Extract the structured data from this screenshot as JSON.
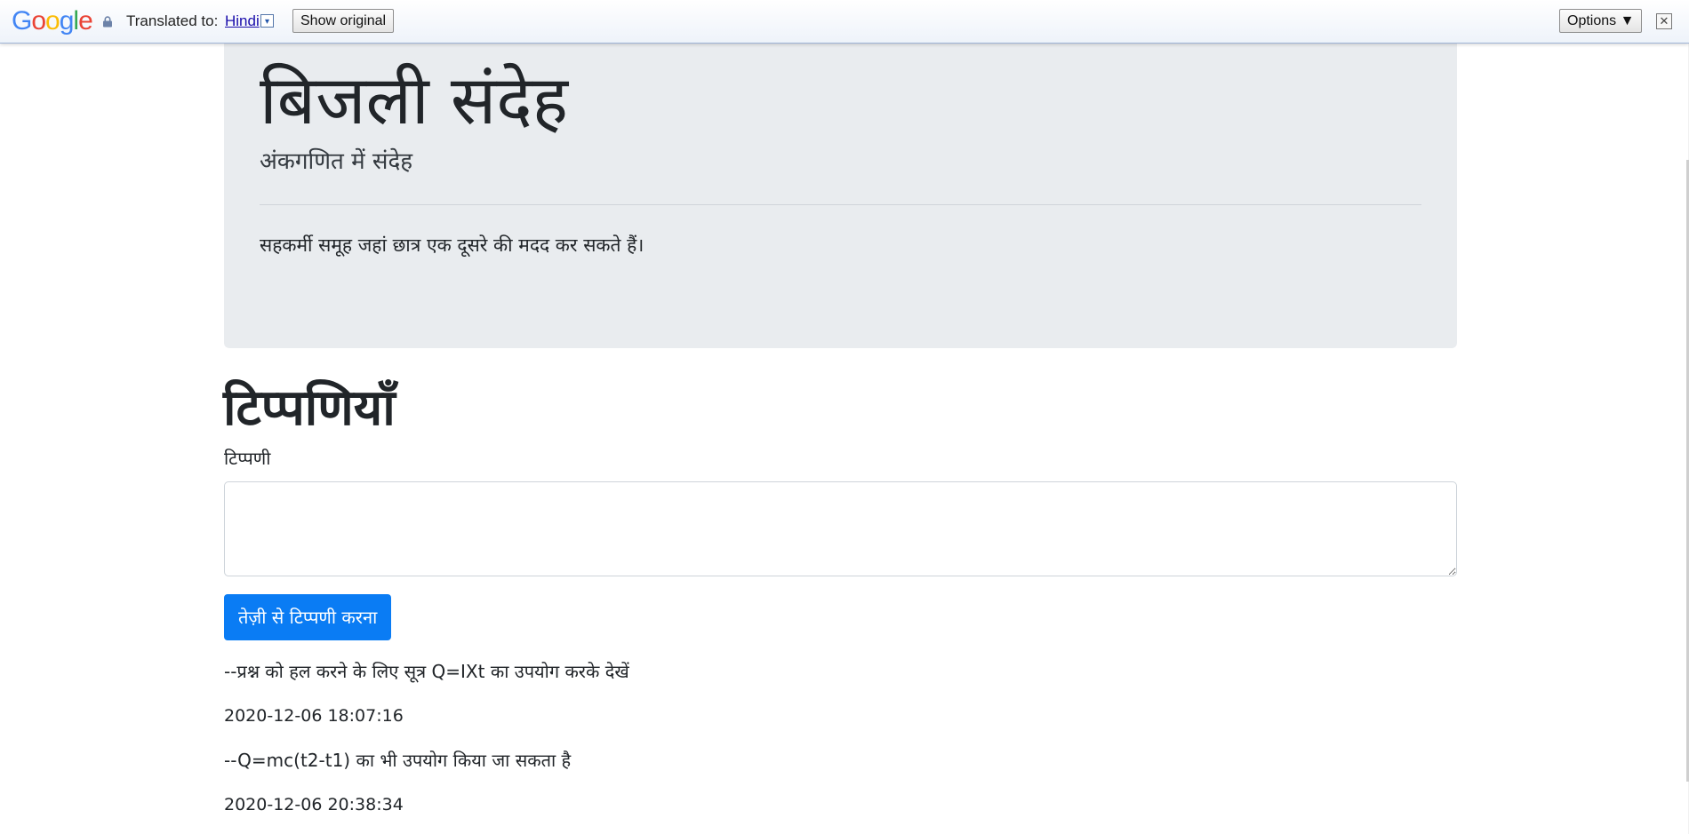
{
  "translate_bar": {
    "logo": [
      "G",
      "o",
      "o",
      "g",
      "l",
      "e"
    ],
    "logo_colors": [
      "#4285F4",
      "#EA4335",
      "#FBBC05",
      "#4285F4",
      "#34A853",
      "#EA4335"
    ],
    "translated_to_label": "Translated to:",
    "language": "Hindi",
    "language_dropdown_glyph": "▾",
    "show_original_label": "Show original",
    "options_label": "Options ▼",
    "close_glyph": "✕",
    "lock_icon": "lock-icon"
  },
  "jumbotron": {
    "title": "बिजली संदेह",
    "subtitle": "अंकगणित में संदेह",
    "description": "सहकर्मी समूह जहां छात्र एक दूसरे की मदद कर सकते हैं।"
  },
  "comments": {
    "heading": "टिप्पणियाँ",
    "field_label": "टिप्पणी",
    "input_value": "",
    "submit_label": "तेज़ी से टिप्पणी करना",
    "items": [
      {
        "text": "--प्रश्न को हल करने के लिए सूत्र Q=IXt का उपयोग करके देखें",
        "timestamp": "2020-12-06 18:07:16"
      },
      {
        "text": "--Q=mc(t2-t1) का भी उपयोग किया जा सकता है",
        "timestamp": "2020-12-06 20:38:34"
      }
    ]
  },
  "colors": {
    "accent": "#0a7cf4",
    "jumbotron_bg": "#e9ecef",
    "link": "#1a0dab"
  }
}
